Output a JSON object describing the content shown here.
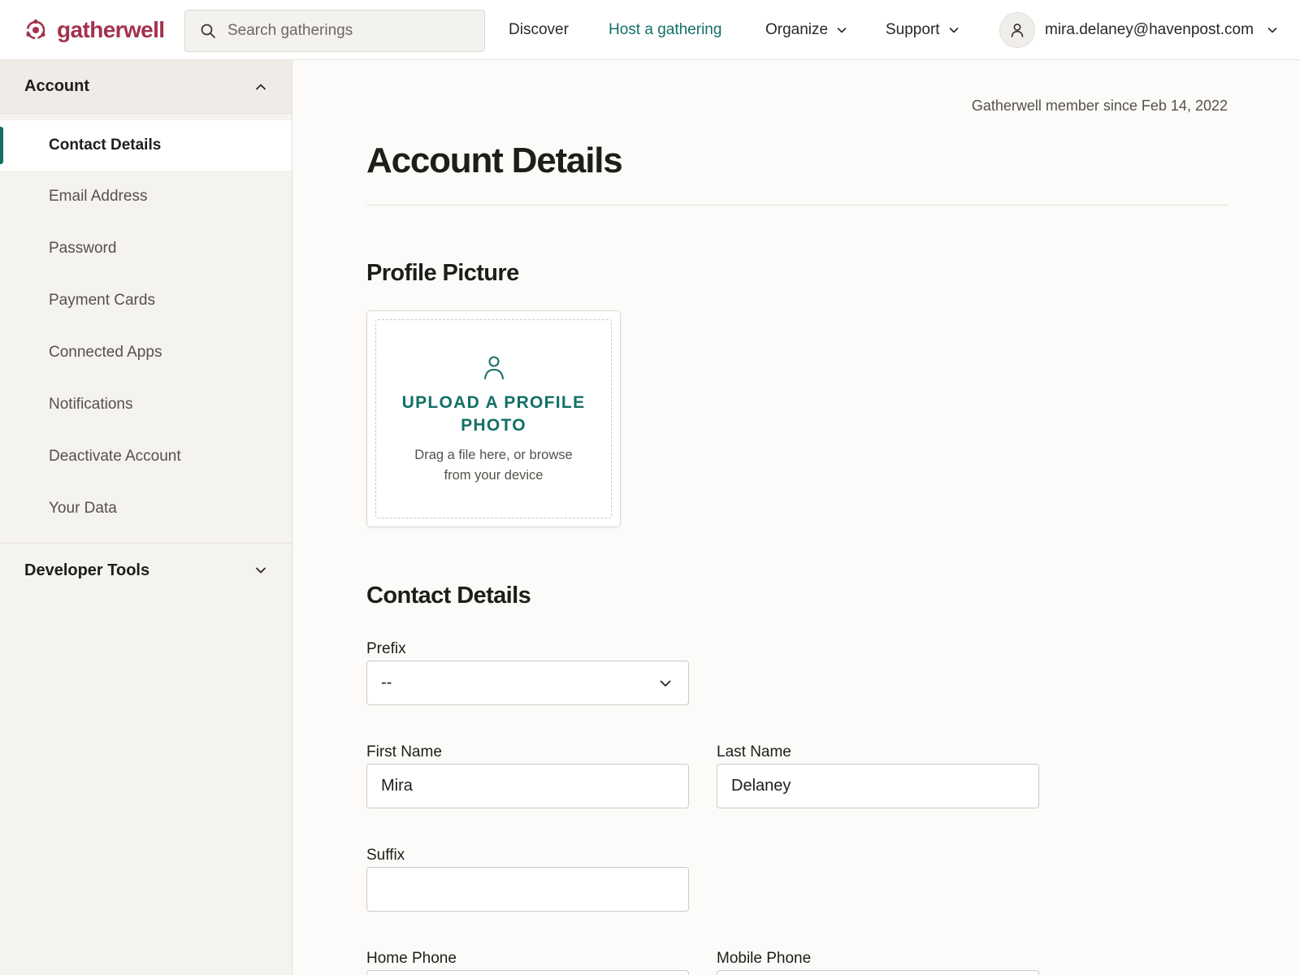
{
  "brand": {
    "name": "gatherwell",
    "color": "#a3324d"
  },
  "accent_color": "#127066",
  "search": {
    "placeholder": "Search gatherings",
    "icon": "search-icon"
  },
  "nav": {
    "discover": "Discover",
    "host": "Host a gathering",
    "organize": "Organize",
    "support": "Support"
  },
  "account_menu": {
    "email": "mira.delaney@havenpost.com",
    "icon": "user-icon"
  },
  "sidebar": {
    "account_title": "Account",
    "account_expanded": true,
    "items": [
      {
        "label": "Contact Details",
        "active": true
      },
      {
        "label": "Email Address",
        "active": false
      },
      {
        "label": "Password",
        "active": false
      },
      {
        "label": "Payment Cards",
        "active": false
      },
      {
        "label": "Connected Apps",
        "active": false
      },
      {
        "label": "Notifications",
        "active": false
      },
      {
        "label": "Deactivate Account",
        "active": false
      },
      {
        "label": "Your Data",
        "active": false
      }
    ],
    "developer_title": "Developer Tools",
    "developer_expanded": false
  },
  "main": {
    "member_since": "Gatherwell member since Feb 14, 2022",
    "page_title": "Account Details",
    "profile_section": "Profile Picture",
    "upload_cta": "UPLOAD A PROFILE PHOTO",
    "upload_hint": "Drag a file here, or browse from your device",
    "contact_section": "Contact Details",
    "fields": {
      "prefix": {
        "label": "Prefix",
        "value": "--"
      },
      "first_name": {
        "label": "First Name",
        "value": "Mira"
      },
      "last_name": {
        "label": "Last Name",
        "value": "Delaney"
      },
      "suffix": {
        "label": "Suffix",
        "value": ""
      },
      "home_phone": {
        "label": "Home Phone",
        "value": ""
      },
      "mobile_phone": {
        "label": "Mobile Phone",
        "value": ""
      }
    }
  }
}
